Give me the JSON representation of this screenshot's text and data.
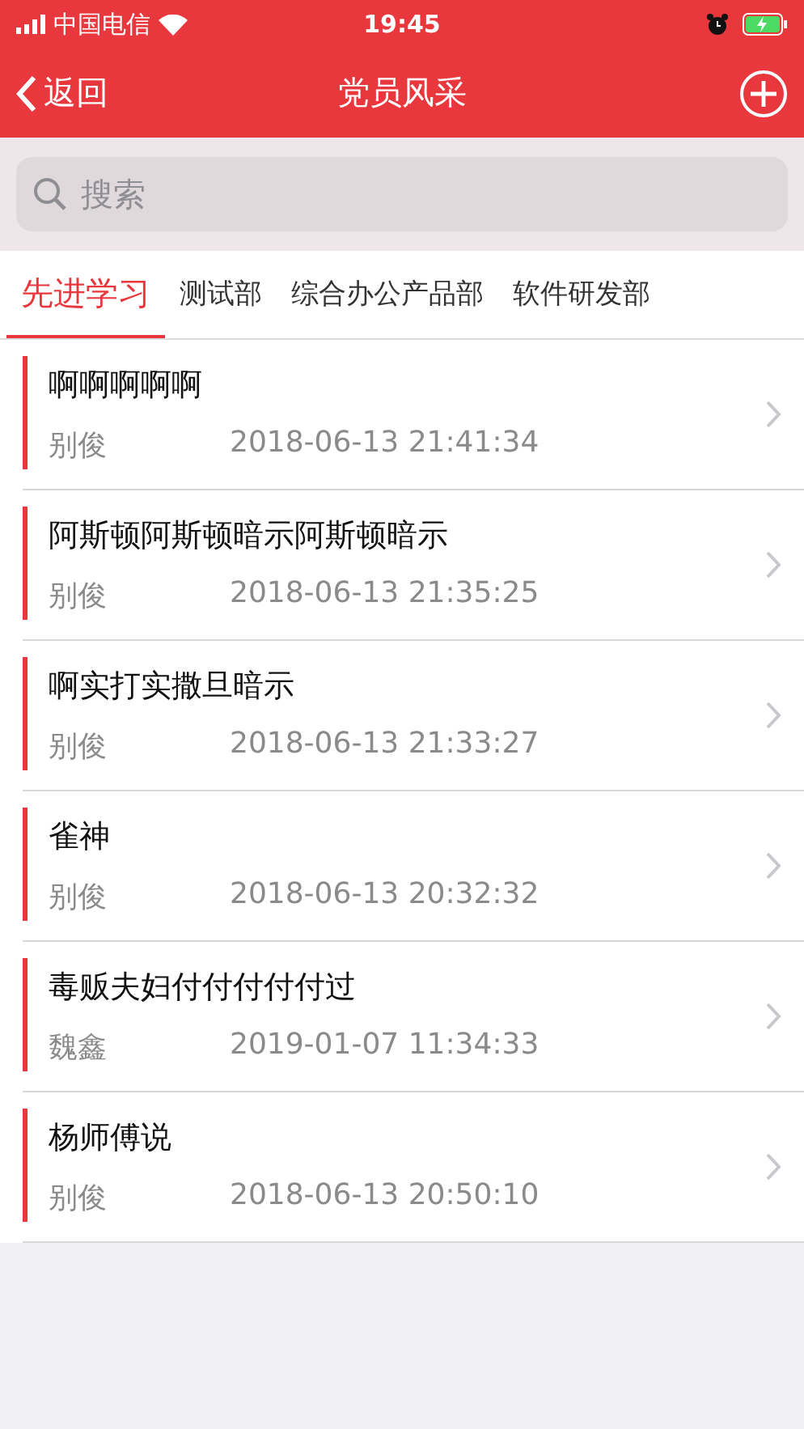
{
  "status_bar": {
    "carrier": "中国电信",
    "time": "19:45"
  },
  "nav": {
    "back": "返回",
    "title": "党员风采"
  },
  "search": {
    "placeholder": "搜索"
  },
  "tabs": [
    {
      "label": "先进学习",
      "selected": true
    },
    {
      "label": "测试部",
      "selected": false
    },
    {
      "label": "综合办公产品部",
      "selected": false
    },
    {
      "label": "软件研发部",
      "selected": false
    }
  ],
  "items": [
    {
      "title": "啊啊啊啊啊",
      "author": "别俊",
      "time": "2018-06-13 21:41:34"
    },
    {
      "title": "阿斯顿阿斯顿暗示阿斯顿暗示",
      "author": "别俊",
      "time": "2018-06-13 21:35:25"
    },
    {
      "title": "啊实打实撒旦暗示",
      "author": "别俊",
      "time": "2018-06-13 21:33:27"
    },
    {
      "title": "雀神",
      "author": "别俊",
      "time": "2018-06-13 20:32:32"
    },
    {
      "title": "毒贩夫妇付付付付付过",
      "author": "魏鑫",
      "time": "2019-01-07 11:34:33"
    },
    {
      "title": "杨师傅说",
      "author": "别俊",
      "time": "2018-06-13 20:50:10"
    }
  ]
}
